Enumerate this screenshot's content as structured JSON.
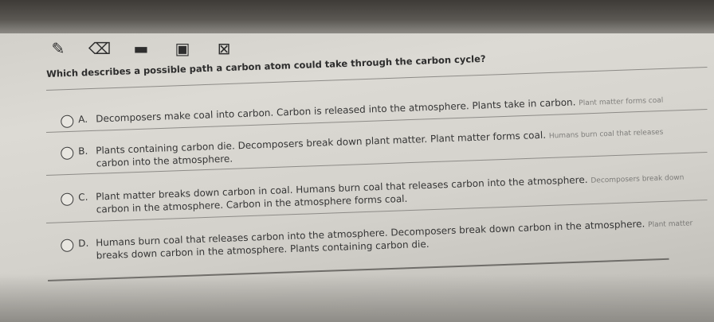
{
  "toolbar": {
    "tools": [
      {
        "name": "pencil-icon",
        "glyph": "✎"
      },
      {
        "name": "eraser-icon",
        "glyph": "⌫"
      },
      {
        "name": "highlighter-icon",
        "glyph": "▬"
      },
      {
        "name": "notepad-icon",
        "glyph": "▣"
      },
      {
        "name": "close-icon",
        "glyph": "⊠"
      }
    ]
  },
  "question": {
    "text": "Which describes a possible path a carbon atom could take through the carbon cycle?"
  },
  "options": [
    {
      "letter": "A.",
      "line1": "Decomposers make coal into carbon. Carbon is released into the atmosphere. Plants take in carbon.",
      "line1_tail": "Plant matter forms coal",
      "line2": ""
    },
    {
      "letter": "B.",
      "line1": "Plants containing carbon die. Decomposers break down plant matter. Plant matter forms coal.",
      "line1_tail": "Humans burn coal that releases",
      "line2": "carbon into the atmosphere."
    },
    {
      "letter": "C.",
      "line1": "Plant matter breaks down carbon in coal. Humans burn coal that releases carbon into the atmosphere.",
      "line1_tail": "Decomposers break down",
      "line2": "carbon in the atmosphere. Carbon in the atmosphere forms coal."
    },
    {
      "letter": "D.",
      "line1": "Humans burn coal that releases carbon into the atmosphere. Decomposers break down carbon in the atmosphere.",
      "line1_tail": "Plant matter",
      "line2": "breaks down carbon in the atmosphere. Plants containing carbon die."
    }
  ]
}
